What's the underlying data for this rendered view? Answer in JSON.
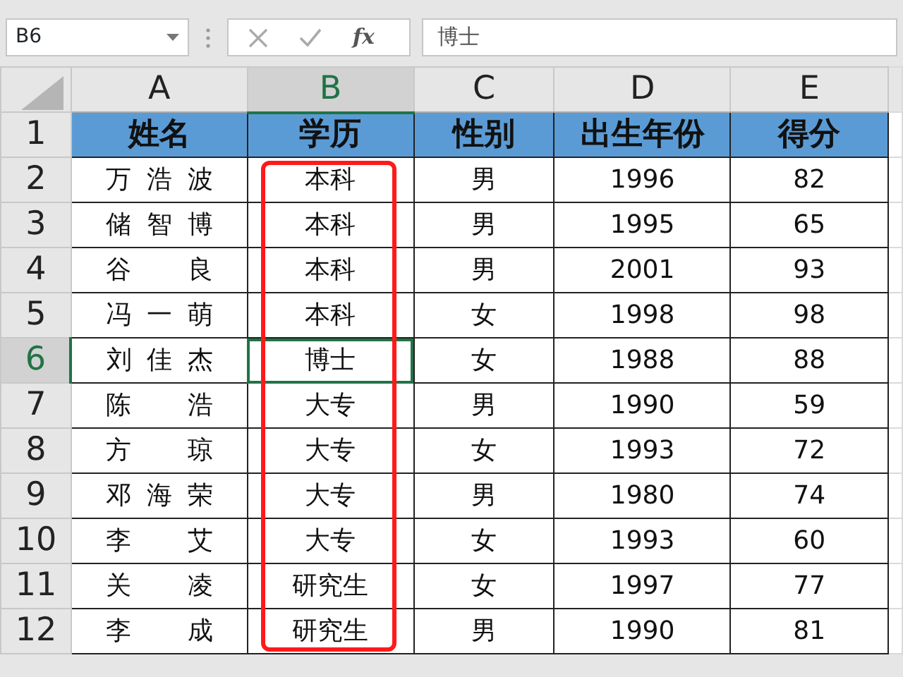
{
  "name_box": "B6",
  "function_label": "fx",
  "formula_value": "博士",
  "columns": [
    {
      "label": "A",
      "selected": false
    },
    {
      "label": "B",
      "selected": true
    },
    {
      "label": "C",
      "selected": false
    },
    {
      "label": "D",
      "selected": false
    },
    {
      "label": "E",
      "selected": false
    }
  ],
  "header_row": {
    "number": "1",
    "cells": [
      "姓名",
      "学历",
      "性别",
      "出生年份",
      "得分"
    ]
  },
  "rows": [
    {
      "number": "2",
      "selected": false,
      "cells": [
        "万浩波",
        "本科",
        "男",
        "1996",
        "82"
      ]
    },
    {
      "number": "3",
      "selected": false,
      "cells": [
        "储智博",
        "本科",
        "男",
        "1995",
        "65"
      ]
    },
    {
      "number": "4",
      "selected": false,
      "cells": [
        "谷良",
        "本科",
        "男",
        "2001",
        "93"
      ]
    },
    {
      "number": "5",
      "selected": false,
      "cells": [
        "冯一萌",
        "本科",
        "女",
        "1998",
        "98"
      ]
    },
    {
      "number": "6",
      "selected": true,
      "cells": [
        "刘佳杰",
        "博士",
        "女",
        "1988",
        "88"
      ]
    },
    {
      "number": "7",
      "selected": false,
      "cells": [
        "陈浩",
        "大专",
        "男",
        "1990",
        "59"
      ]
    },
    {
      "number": "8",
      "selected": false,
      "cells": [
        "方琼",
        "大专",
        "女",
        "1993",
        "72"
      ]
    },
    {
      "number": "9",
      "selected": false,
      "cells": [
        "邓海荣",
        "大专",
        "男",
        "1980",
        "74"
      ]
    },
    {
      "number": "10",
      "selected": false,
      "cells": [
        "李艾",
        "大专",
        "女",
        "1993",
        "60"
      ]
    },
    {
      "number": "11",
      "selected": false,
      "cells": [
        "关凌",
        "研究生",
        "女",
        "1997",
        "77"
      ]
    },
    {
      "number": "12",
      "selected": false,
      "cells": [
        "李成",
        "研究生",
        "男",
        "1990",
        "81"
      ]
    }
  ]
}
